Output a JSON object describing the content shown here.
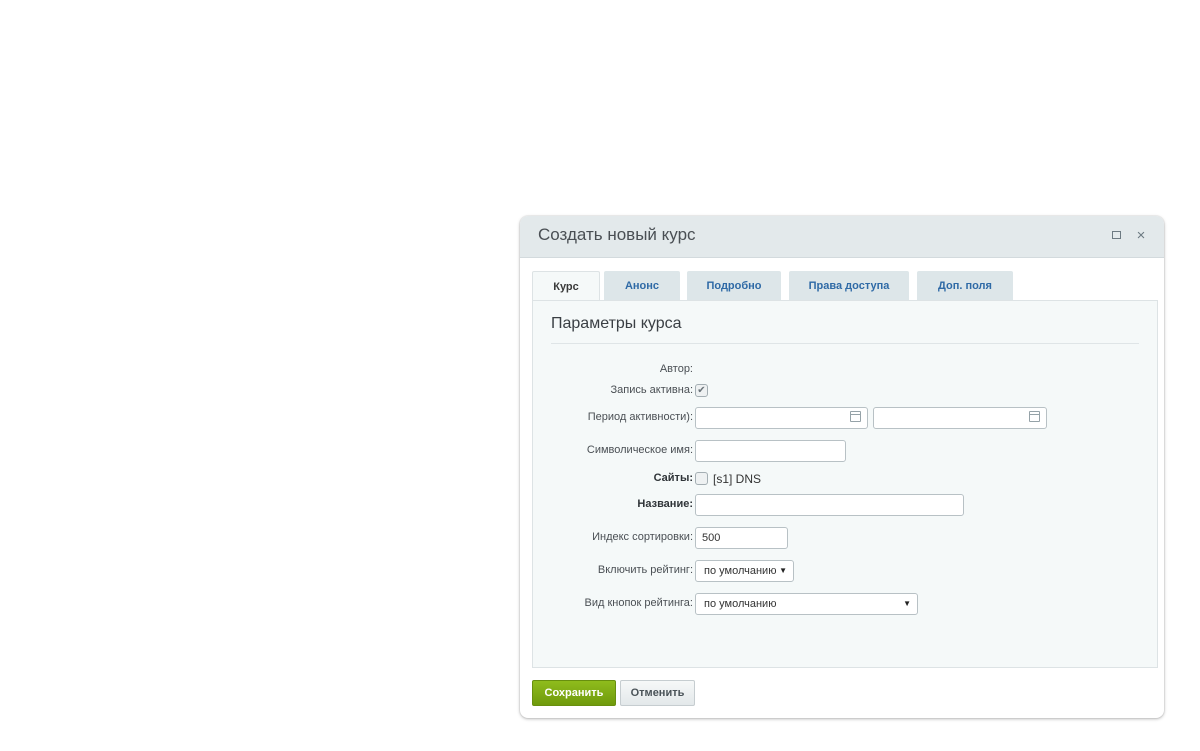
{
  "dialog": {
    "title": "Создать новый курс",
    "maximize_icon": "maximize-icon",
    "close_icon": "close-icon",
    "close_glyph": "×"
  },
  "tabs": [
    {
      "label": "Курс",
      "active": true
    },
    {
      "label": "Анонс",
      "active": false
    },
    {
      "label": "Подробно",
      "active": false
    },
    {
      "label": "Права доступа",
      "active": false
    },
    {
      "label": "Доп. поля",
      "active": false
    }
  ],
  "section": {
    "title": "Параметры курса"
  },
  "form": {
    "author_label": "Автор:",
    "active_label": "Запись активна:",
    "active_checked": true,
    "period_label": "Период активности):",
    "period_from": "",
    "period_to": "",
    "code_label": "Символическое имя:",
    "code_value": "",
    "sites_label": "Сайты:",
    "site_option": "[s1] DNS",
    "site_checked": false,
    "name_label": "Название:",
    "name_value": "",
    "sort_label": "Индекс сортировки:",
    "sort_value": "500",
    "rating_label": "Включить рейтинг:",
    "rating_value": "по умолчанию",
    "rating_buttons_label": "Вид кнопок рейтинга:",
    "rating_buttons_value": "по умолчанию",
    "check_glyph": "✔",
    "arrow_glyph": "▼"
  },
  "buttons": {
    "save": "Сохранить",
    "cancel": "Отменить"
  },
  "colors": {
    "save_button": "#7aa614",
    "tab_link": "#2f6aa6",
    "titlebar": "#e3e9eb"
  }
}
